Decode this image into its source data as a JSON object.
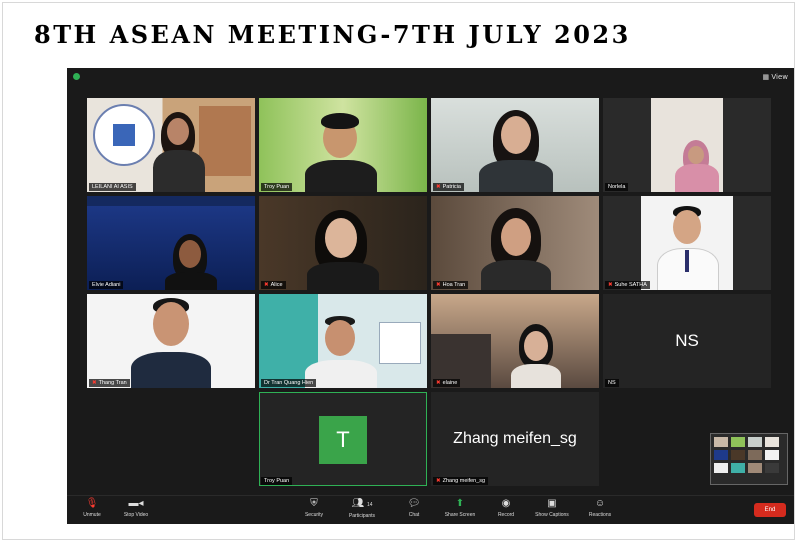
{
  "slide": {
    "title": "8TH ASEAN MEETING-7TH JULY 2023"
  },
  "zoom": {
    "top_bar": {
      "view_label": "View"
    },
    "participants": [
      {
        "name": "LEILANI AI ASIS",
        "muted": false
      },
      {
        "name": "Troy Puan",
        "muted": false
      },
      {
        "name": "Patricia",
        "muted": true
      },
      {
        "name": "Norlela",
        "muted": false
      },
      {
        "name": "Elvie Adiani",
        "muted": false
      },
      {
        "name": "Alice",
        "muted": true
      },
      {
        "name": "Hoa Tran",
        "muted": true
      },
      {
        "name": "Suhe SATHA",
        "muted": true
      },
      {
        "name": "Thang Tran",
        "muted": true
      },
      {
        "name": "Dr Tran Quang Hien",
        "muted": false
      },
      {
        "name": "elaine",
        "muted": true
      },
      {
        "name": "NS",
        "muted": false,
        "initials": "NS"
      },
      {
        "name": "Troy Puan",
        "muted": false,
        "initials": "T"
      },
      {
        "name": "Zhang meifen_sg",
        "muted": true,
        "display_text": "Zhang meifen_sg"
      }
    ],
    "toolbar": {
      "unmute": "Unmute",
      "stop_video": "Stop Video",
      "security": "Security",
      "participants": "Participants",
      "participants_count": "14",
      "chat": "Chat",
      "share_screen": "Share Screen",
      "record": "Record",
      "show_captions": "Show Captions",
      "reactions": "Reactions",
      "end": "End"
    }
  }
}
